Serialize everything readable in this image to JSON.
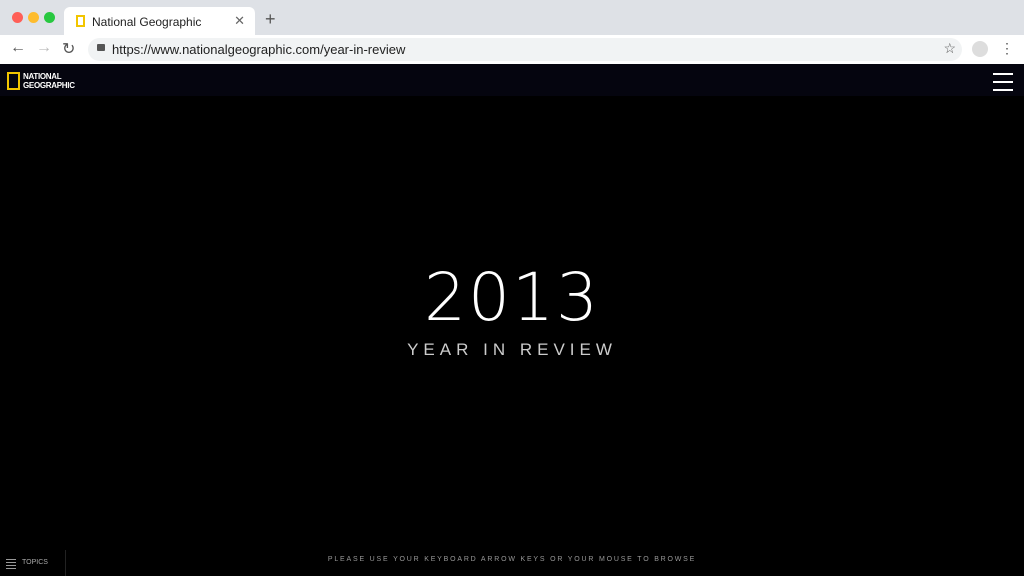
{
  "browser": {
    "tab_title": "National Geographic",
    "url": "https://www.nationalgeographic.com/year-in-review",
    "window_buttons": {
      "close": "#ff5f57",
      "minimize": "#febc2e",
      "maximize": "#28c840"
    }
  },
  "site": {
    "logo": "NATIONAL GEOGRAPHIC",
    "logo_lines": [
      "NATIONAL",
      "GEOGRAPHIC"
    ],
    "brand_color": "#f2c500"
  },
  "hero": {
    "year": "2013",
    "subtitle": "YEAR IN REVIEW"
  },
  "footer": {
    "topics_label": "TOPICS",
    "hint": "PLEASE USE YOUR KEYBOARD ARROW KEYS OR YOUR MOUSE TO BROWSE"
  }
}
